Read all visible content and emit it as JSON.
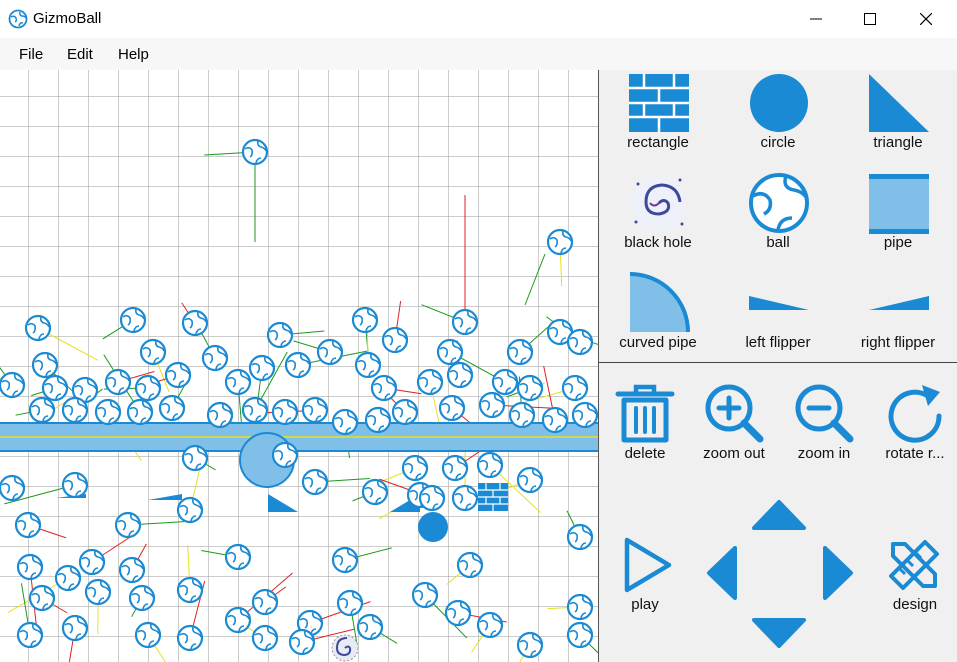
{
  "window": {
    "title": "GizmoBall",
    "icon": "globe-icon"
  },
  "menu": {
    "items": [
      "File",
      "Edit",
      "Help"
    ]
  },
  "colors": {
    "accent": "#1a8ad4",
    "accent_light": "#7fbfe8",
    "grid": "#9a9a9a",
    "line_green": "#1a9a1a",
    "line_red": "#e02020",
    "line_yellow": "#e8e020"
  },
  "toolbox": {
    "items": [
      {
        "label": "rectangle",
        "icon": "brick-wall-icon"
      },
      {
        "label": "circle",
        "icon": "circle-icon"
      },
      {
        "label": "triangle",
        "icon": "triangle-icon"
      },
      {
        "label": "black hole",
        "icon": "spiral-galaxy-icon"
      },
      {
        "label": "ball",
        "icon": "globe-ball-icon"
      },
      {
        "label": "pipe",
        "icon": "pipe-icon"
      },
      {
        "label": "curved pipe",
        "icon": "quarter-circle-icon"
      },
      {
        "label": "left flipper",
        "icon": "left-flipper-icon"
      },
      {
        "label": "right flipper",
        "icon": "right-flipper-icon"
      }
    ]
  },
  "controls": {
    "delete_label": "delete",
    "zoom_out_label": "zoom out",
    "zoom_in_label": "zoom in",
    "rotate_label": "rotate r...",
    "play_label": "play",
    "design_label": "design"
  }
}
